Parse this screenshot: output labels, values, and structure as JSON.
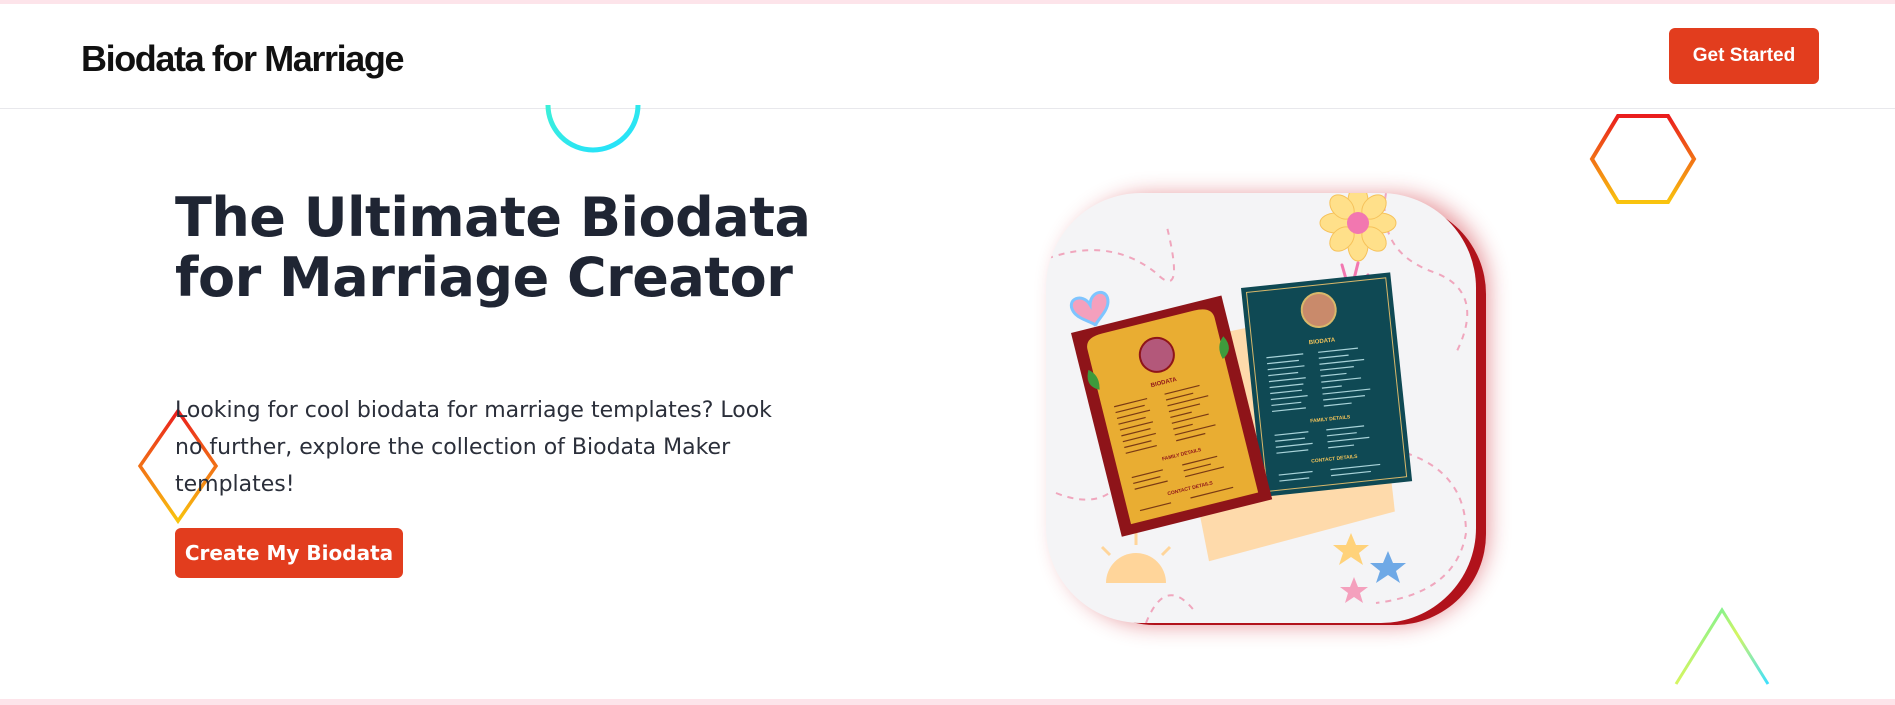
{
  "header": {
    "brand": "Biodata for Marriage",
    "cta_label": "Get Started"
  },
  "hero": {
    "title": "The Ultimate Biodata for Marriage Creator",
    "description": "Looking for cool biodata for marriage templates? Look no further, explore the collection of Biodata Maker templates!",
    "cta_label": "Create My Biodata"
  },
  "preview": {
    "left_card_heading": "BIODATA",
    "left_card_section": "FAMILY DETAILS",
    "left_card_contact": "CONTACT DETAILS",
    "right_card_heading": "BIODATA",
    "right_card_section": "FAMILY DETAILS",
    "right_card_contact": "CONTACT DETAILS"
  },
  "colors": {
    "accent": "#e23d1e",
    "text_dark": "#1f2533",
    "stripe": "#fde4ea",
    "card_shadow": "#b1121b"
  },
  "icons": [
    "ring-shape",
    "hexagon-shape",
    "diamond-shape",
    "triangle-shape",
    "flower-icon",
    "heart-icon",
    "star-icon"
  ]
}
